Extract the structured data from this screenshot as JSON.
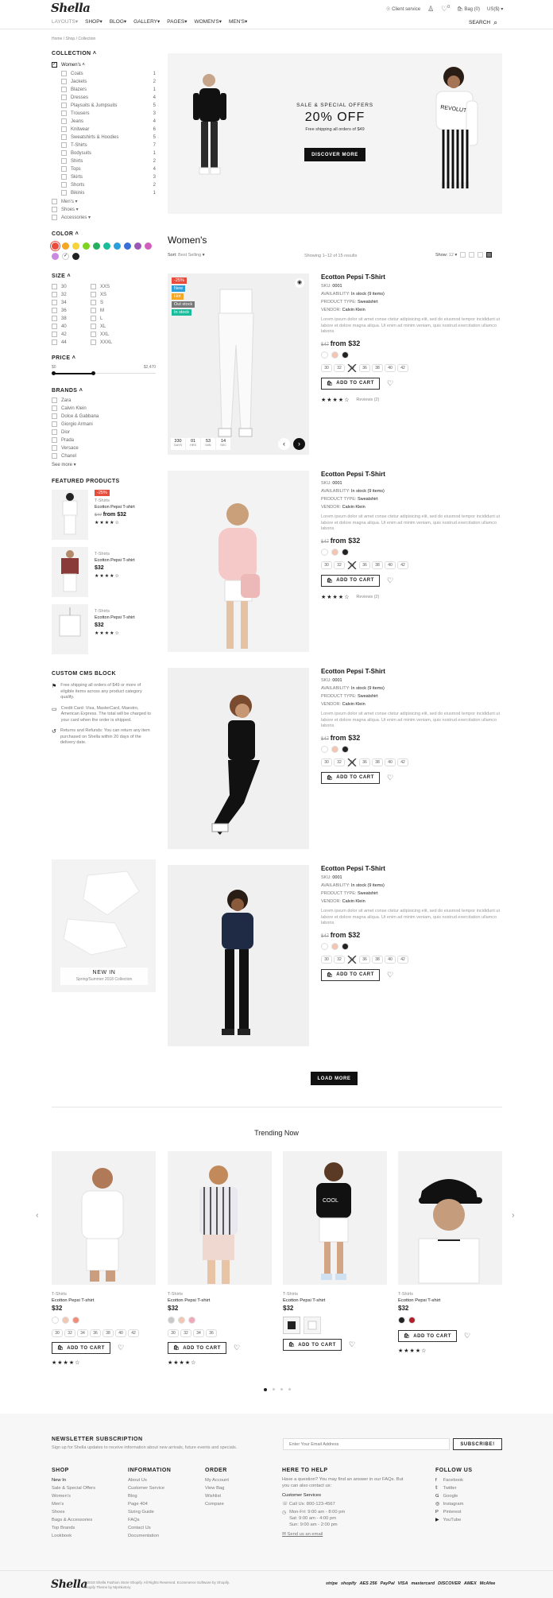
{
  "header": {
    "logo": "Shella",
    "nav": [
      "LAYOUTS",
      "SHOP",
      "BLOG",
      "GALLERY",
      "PAGES",
      "WOMEN'S",
      "MEN'S"
    ],
    "client_service": "Client service",
    "bag": "Bag (0)",
    "currency": "US($)",
    "wishlist_count": "0",
    "search": "SEARCH"
  },
  "breadcrumb": [
    "Home",
    "Shop",
    "Collection"
  ],
  "sidebar": {
    "collection_title": "COLLECTION",
    "collection_parent": "Women's",
    "collection_items": [
      {
        "label": "Coats",
        "count": "1"
      },
      {
        "label": "Jackets",
        "count": "2"
      },
      {
        "label": "Blazers",
        "count": "1"
      },
      {
        "label": "Dresses",
        "count": "4"
      },
      {
        "label": "Playsuits & Jumpsuits",
        "count": "5"
      },
      {
        "label": "Trousers",
        "count": "3"
      },
      {
        "label": "Jeans",
        "count": "4"
      },
      {
        "label": "Knitwear",
        "count": "6"
      },
      {
        "label": "Sweatshirts & Hoodies",
        "count": "5"
      },
      {
        "label": "T-Shirts",
        "count": "7"
      },
      {
        "label": "Bodysuits",
        "count": "1"
      },
      {
        "label": "Shirts",
        "count": "2"
      },
      {
        "label": "Tops",
        "count": "4"
      },
      {
        "label": "Skirts",
        "count": "3"
      },
      {
        "label": "Shorts",
        "count": "2"
      },
      {
        "label": "Bikinis",
        "count": "1"
      }
    ],
    "collection_more": [
      "Men's",
      "Shoes",
      "Accessories"
    ],
    "color_title": "COLOR",
    "colors": [
      "#e74c3c",
      "#f5a623",
      "#f8d23a",
      "#7ed321",
      "#27ae60",
      "#1abc9c",
      "#2b9fd9",
      "#3b6fd8",
      "#9b59b6",
      "#d35fbd",
      "#c98be0",
      "#ffffff",
      "#222222"
    ],
    "size_title": "SIZE",
    "sizes_left": [
      "30",
      "32",
      "34",
      "36",
      "38",
      "40",
      "42",
      "44"
    ],
    "sizes_right": [
      "XXS",
      "XS",
      "S",
      "M",
      "L",
      "XL",
      "XXL",
      "XXXL"
    ],
    "price_title": "PRICE",
    "price_min": "$0",
    "price_max": "$2,470",
    "brands_title": "BRANDS",
    "brands": [
      "Zara",
      "Calvin Klein",
      "Dolce & Gabbana",
      "Giorgio Armani",
      "Dior",
      "Prada",
      "Versace",
      "Chanel"
    ],
    "see_more": "See more",
    "featured_title": "FEATURED PRODUCTS",
    "featured": [
      {
        "type": "T-Shirts",
        "name": "Ecotton Pepsi T-shirt",
        "old": "$47",
        "price": "from $32",
        "badge": "-25%"
      },
      {
        "type": "T-Shirts",
        "name": "Ecotton Pepsi T-shirt",
        "old": "",
        "price": "$32",
        "badge": ""
      },
      {
        "type": "T-Shirts",
        "name": "Ecotton Pepsi T-shirt",
        "old": "",
        "price": "$32",
        "badge": ""
      }
    ],
    "cms_title": "CUSTOM CMS BLOCK",
    "cms_items": [
      "Free shipping all orders of $49 or more of eligible items across any product category qualify.",
      "Credit Card: Visa, MasterCard, Maestro, American Express. The total will be charged to your card when the order is shipped.",
      "Returns and Refunds: You can return any item purchased on Shella within 20 days of the delivery date."
    ],
    "promo_title": "NEW IN",
    "promo_sub": "Spring/Summer 2018 Collection"
  },
  "hero": {
    "kicker": "SALE & SPECIAL OFFERS",
    "title": "20% OFF",
    "sub": "Free shipping all orders of $49",
    "cta": "DISCOVER MORE"
  },
  "listing": {
    "title": "Women's",
    "sort_label": "Sort:",
    "sort_value": "Best Selling",
    "showing": "Showing 1–12 of 15 results",
    "show_label": "Show:",
    "show_value": "12"
  },
  "product_common": {
    "name": "Ecotton Pepsi T-Shirt",
    "sku_label": "SKU:",
    "sku": "0001",
    "avail_label": "AVAILABILITY:",
    "avail": "In stock (9 items)",
    "ptype_label": "PRODUCT TYPE:",
    "ptype": "Sweatshirt",
    "vendor_label": "VENDOR:",
    "vendor": "Calvin Klein",
    "desc": "Lorem ipsum dolor sit amet conse ctetur adipisicing elit, sed do eiusmod tempor incididunt ut labore et dolore magna aliqua. Ut enim ad minim veniam, quis nostrud exercitation ullamco laboris.",
    "old": "$47",
    "price": "from $32",
    "sizes": [
      "30",
      "32",
      "34",
      "36",
      "38",
      "40",
      "42"
    ],
    "add_to_cart": "ADD TO CART",
    "reviews": "Reviews (2)"
  },
  "product1_badges": [
    "-25%",
    "New",
    "Hot",
    "Out stock",
    "In stock"
  ],
  "countdown": [
    {
      "v": "330",
      "l": "DAYS"
    },
    {
      "v": "01",
      "l": "HRS"
    },
    {
      "v": "53",
      "l": "MIN"
    },
    {
      "v": "14",
      "l": "SEC"
    }
  ],
  "load_more": "LOAD MORE",
  "trending": {
    "title": "Trending Now",
    "items": [
      {
        "type": "T-Shirts",
        "name": "Ecotton Pepsi T-shirt",
        "price": "$32",
        "sizes": [
          "30",
          "32",
          "34",
          "36",
          "38",
          "40",
          "42"
        ]
      },
      {
        "type": "T-Shirts",
        "name": "Ecotton Pepsi T-shirt",
        "price": "$32",
        "sizes": [
          "30",
          "32",
          "34",
          "36"
        ]
      },
      {
        "type": "T-Shirts",
        "name": "Ecotton Pepsi T-shirt",
        "price": "$32",
        "sizes": []
      },
      {
        "type": "T-Shirts",
        "name": "Ecotton Pepsi T-shirt",
        "price": "$32",
        "sizes": []
      }
    ],
    "add_to_cart": "ADD TO CART"
  },
  "newsletter": {
    "title": "NEWSLETTER SUBSCRIPTION",
    "sub": "Sign up for Shella updates to receive information about new arrivals, future events and specials.",
    "placeholder": "Enter Your Email Address",
    "button": "SUBSCRIBE!"
  },
  "footer": {
    "shop_title": "SHOP",
    "shop": [
      "New In",
      "Sale & Special Offers",
      "Women's",
      "Men's",
      "Shoes",
      "Bags & Accessories",
      "Top Brands",
      "Lookbook"
    ],
    "info_title": "INFORMATION",
    "info": [
      "About Us",
      "Customer Service",
      "Blog",
      "Page 404",
      "Sizing Guide",
      "FAQs",
      "Contact Us",
      "Documentation"
    ],
    "order_title": "ORDER",
    "order": [
      "My Account",
      "View Bag",
      "Wishlist",
      "Compare"
    ],
    "help_title": "HERE TO HELP",
    "help_text": "Have a question? You may find an answer in our FAQs. But you can also contact us:",
    "help_service": "Customer Services",
    "help_phone": "Call Us: 800-123-4567",
    "help_hours": [
      "Mon-Fri: 9:00 am - 8:00 pm",
      "Sat: 9:00 am - 4:00 pm",
      "Sun: 9:00 am - 2:00 pm"
    ],
    "help_email": "Send us an email",
    "follow_title": "FOLLOW US",
    "follow": [
      "Facebook",
      "Twitter",
      "Google",
      "Instagram",
      "Pinterest",
      "YouTube"
    ],
    "copyright": "© 2018 Shella Fashion Store Shopify. All Rights Reserved. Ecommerce Software by Shopify.",
    "theme": "Shopify Theme by Mpmkvtory",
    "payments": [
      "stripe",
      "shopify",
      "AES 256",
      "PayPal",
      "VISA",
      "mastercard",
      "DISCOVER",
      "AMEX",
      "McAfee"
    ]
  }
}
